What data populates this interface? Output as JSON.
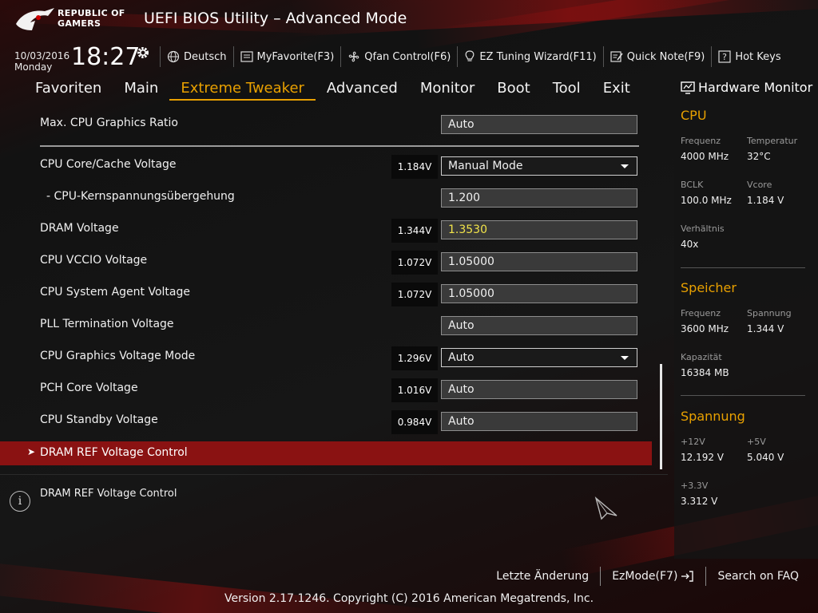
{
  "header": {
    "brand_line1": "REPUBLIC OF",
    "brand_line2": "GAMERS",
    "title": "UEFI BIOS Utility – Advanced Mode"
  },
  "clock": {
    "date": "10/03/2016",
    "day": "Monday",
    "time": "18:27"
  },
  "toolbar": [
    {
      "icon": "globe-icon",
      "label": "Deutsch"
    },
    {
      "icon": "favorite-icon",
      "label": "MyFavorite(F3)"
    },
    {
      "icon": "fan-icon",
      "label": "Qfan Control(F6)"
    },
    {
      "icon": "bulb-icon",
      "label": "EZ Tuning Wizard(F11)"
    },
    {
      "icon": "note-icon",
      "label": "Quick Note(F9)"
    },
    {
      "icon": "question-icon",
      "label": "Hot Keys"
    }
  ],
  "nav": {
    "tabs": [
      "Favoriten",
      "Main",
      "Extreme Tweaker",
      "Advanced",
      "Monitor",
      "Boot",
      "Tool",
      "Exit"
    ],
    "active": "Extreme Tweaker"
  },
  "settings": [
    {
      "label": "Max. CPU Graphics Ratio",
      "voltage": "",
      "value": "Auto"
    },
    {
      "label": "CPU Core/Cache Voltage",
      "voltage": "1.184V",
      "value": "Manual Mode"
    },
    {
      "label": "- CPU-Kernspannungsübergehung",
      "voltage": "",
      "value": "1.200"
    },
    {
      "label": "DRAM Voltage",
      "voltage": "1.344V",
      "value": "1.3530"
    },
    {
      "label": "CPU VCCIO Voltage",
      "voltage": "1.072V",
      "value": "1.05000"
    },
    {
      "label": "CPU System Agent Voltage",
      "voltage": "1.072V",
      "value": "1.05000"
    },
    {
      "label": "PLL Termination Voltage",
      "voltage": "",
      "value": "Auto"
    },
    {
      "label": "CPU Graphics Voltage Mode",
      "voltage": "1.296V",
      "value": "Auto"
    },
    {
      "label": "PCH Core Voltage",
      "voltage": "1.016V",
      "value": "Auto"
    },
    {
      "label": "CPU Standby Voltage",
      "voltage": "0.984V",
      "value": "Auto"
    }
  ],
  "submenu": {
    "label": "DRAM REF Voltage Control"
  },
  "help": {
    "text": "DRAM REF Voltage Control"
  },
  "hw_monitor": {
    "title": "Hardware Monitor",
    "cpu": {
      "heading": "CPU",
      "freq_label": "Frequenz",
      "freq": "4000 MHz",
      "temp_label": "Temperatur",
      "temp": "32°C",
      "bclk_label": "BCLK",
      "bclk": "100.0 MHz",
      "vcore_label": "Vcore",
      "vcore": "1.184 V",
      "ratio_label": "Verhältnis",
      "ratio": "40x"
    },
    "memory": {
      "heading": "Speicher",
      "freq_label": "Frequenz",
      "freq": "3600 MHz",
      "volt_label": "Spannung",
      "volt": "1.344 V",
      "cap_label": "Kapazität",
      "cap": "16384 MB"
    },
    "voltage": {
      "heading": "Spannung",
      "v12_label": "+12V",
      "v12": "12.192 V",
      "v5_label": "+5V",
      "v5": "5.040 V",
      "v33_label": "+3.3V",
      "v33": "3.312 V"
    }
  },
  "footer": {
    "last_change": "Letzte Änderung",
    "ezmode": "EzMode(F7)",
    "faq": "Search on FAQ",
    "copyright": "Version 2.17.1246. Copyright (C) 2016 American Megatrends, Inc."
  },
  "colors": {
    "accent": "#e8a000",
    "highlight_bar": "#8a1212",
    "changed_value": "#f2e44a"
  }
}
